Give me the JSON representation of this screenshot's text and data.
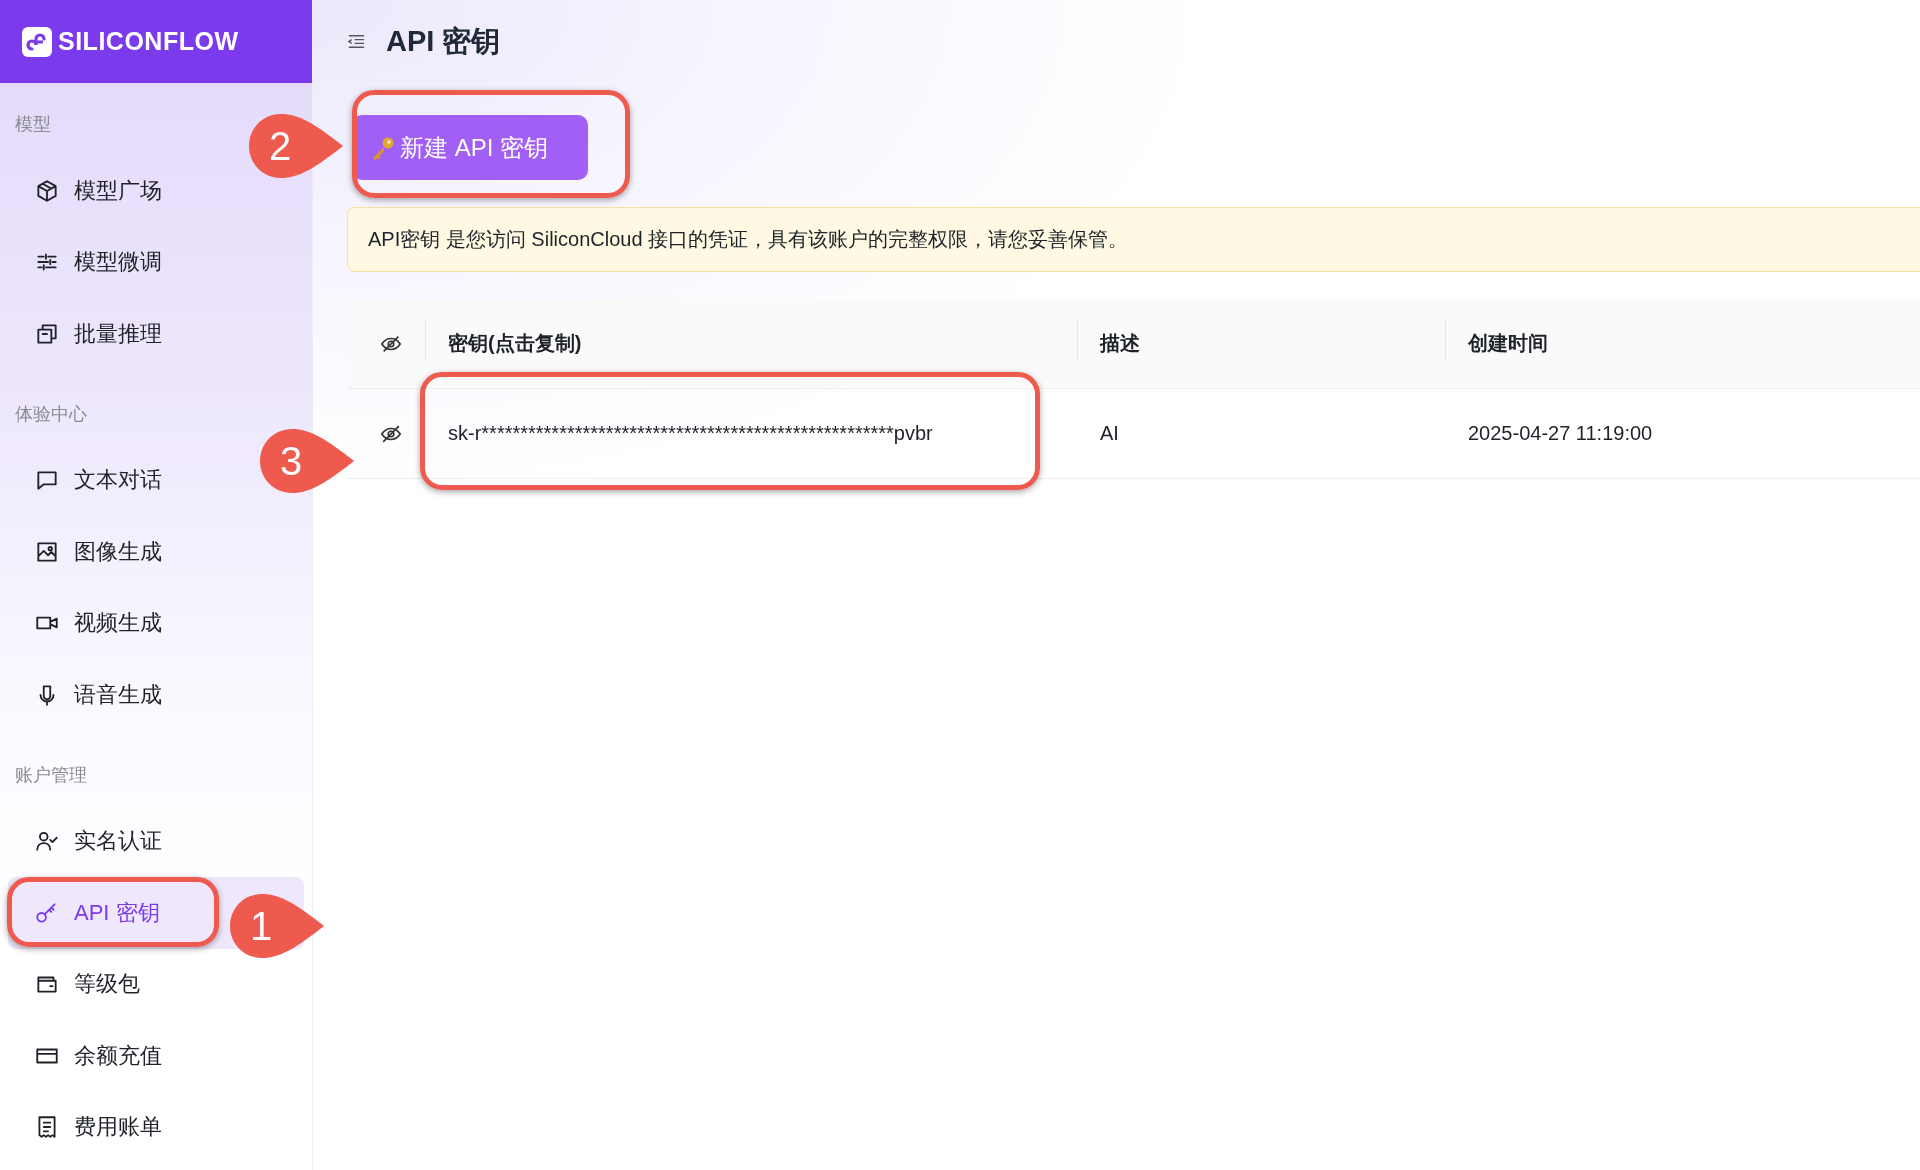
{
  "brand": {
    "logo_text": "SILICONFLOW"
  },
  "sidebar": {
    "sections": [
      {
        "title": "模型",
        "items": [
          {
            "label": "模型广场",
            "selected": false
          },
          {
            "label": "模型微调",
            "selected": false
          },
          {
            "label": "批量推理",
            "selected": false
          }
        ]
      },
      {
        "title": "体验中心",
        "items": [
          {
            "label": "文本对话",
            "selected": false
          },
          {
            "label": "图像生成",
            "selected": false
          },
          {
            "label": "视频生成",
            "selected": false
          },
          {
            "label": "语音生成",
            "selected": false
          }
        ]
      },
      {
        "title": "账户管理",
        "items": [
          {
            "label": "实名认证",
            "selected": false
          },
          {
            "label": "API 密钥",
            "selected": true
          },
          {
            "label": "等级包",
            "selected": false
          },
          {
            "label": "余额充值",
            "selected": false
          },
          {
            "label": "费用账单",
            "selected": false
          }
        ]
      }
    ]
  },
  "header": {
    "title": "API 密钥"
  },
  "new_key_button": {
    "label": "新建 API 密钥"
  },
  "notice": "API密钥 是您访问 SiliconCloud 接口的凭证，具有该账户的完整权限，请您妥善保管。",
  "table": {
    "columns": [
      "密钥(点击复制)",
      "描述",
      "创建时间"
    ],
    "rows": [
      {
        "key": "sk-r*****************************************************pvbr",
        "description": "AI",
        "created": "2025-04-27 11:19:00"
      }
    ]
  },
  "callouts": [
    {
      "label": "2"
    },
    {
      "label": "3"
    },
    {
      "label": "1"
    }
  ]
}
